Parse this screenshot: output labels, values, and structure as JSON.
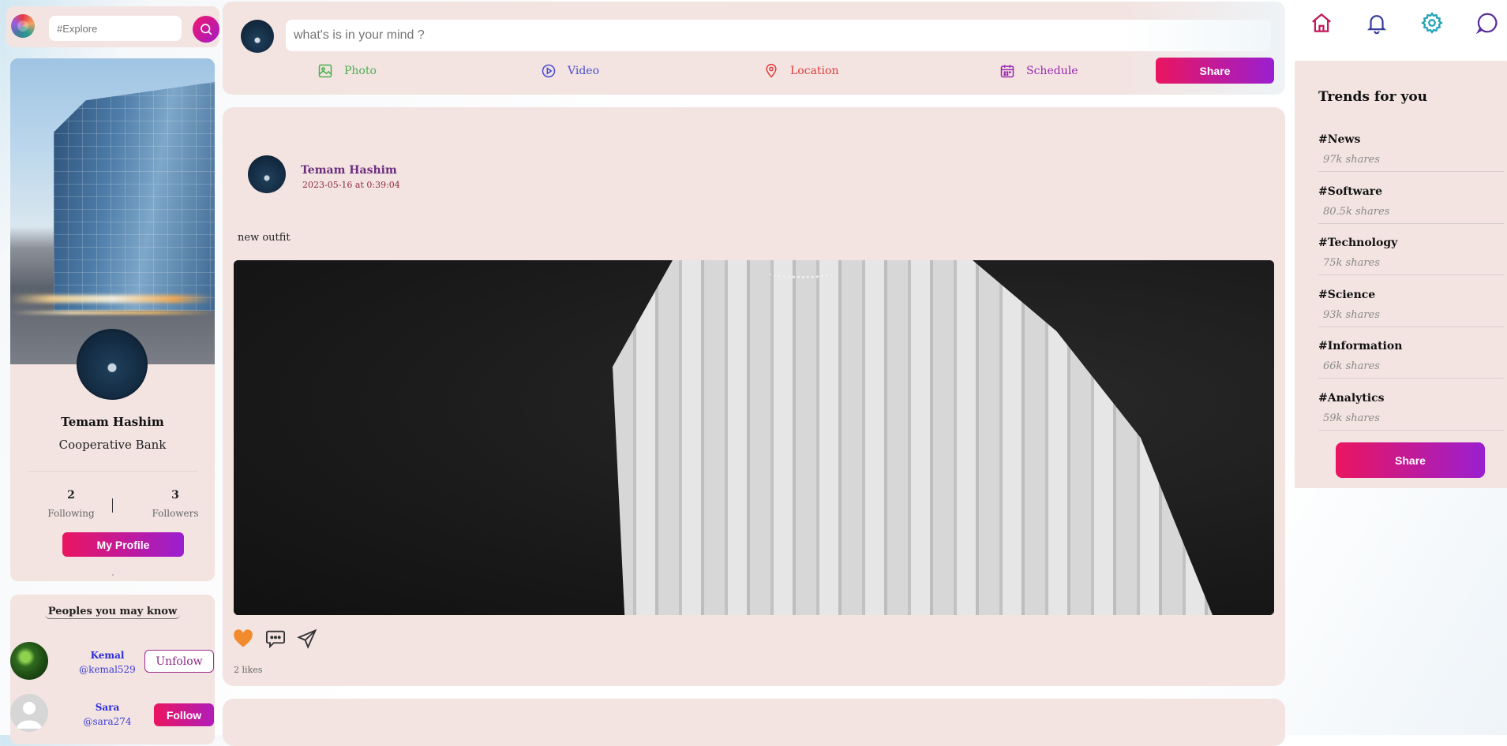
{
  "search": {
    "placeholder": "#Explore"
  },
  "profile": {
    "name": "Temam Hashim",
    "company": "Cooperative Bank",
    "following_count": "2",
    "following_label": "Following",
    "followers_count": "3",
    "followers_label": "Followers",
    "my_profile_label": "My Profile"
  },
  "people": {
    "title": "Peoples you may know",
    "list": [
      {
        "name": "Kemal",
        "handle": "@kemal529",
        "action": "Unfolow"
      },
      {
        "name": "Sara",
        "handle": "@sara274",
        "action": "Follow"
      }
    ]
  },
  "composer": {
    "placeholder": "what's is in your mind ?",
    "options": [
      {
        "label": "Photo",
        "icon": "image-icon",
        "color": "#4caf50"
      },
      {
        "label": "Video",
        "icon": "play-circle-icon",
        "color": "#4a4ad0"
      },
      {
        "label": "Location",
        "icon": "map-pin-icon",
        "color": "#e23b3b"
      },
      {
        "label": "Schedule",
        "icon": "calendar-icon",
        "color": "#9b27b0"
      }
    ],
    "share_label": "Share"
  },
  "post": {
    "author": "Temam Hashim",
    "timestamp": "2023-05-16 at 0:39:04",
    "text": "new outfit",
    "likes": "2 likes"
  },
  "nav": {
    "icons": [
      "home-icon",
      "bell-icon",
      "gear-icon",
      "chat-icon"
    ],
    "colors": [
      "#c2185b",
      "#3a3f9e",
      "#1fa3b3",
      "#5a2d9e"
    ]
  },
  "trends": {
    "title": "Trends for you",
    "items": [
      {
        "tag": "#News",
        "shares": "97k shares"
      },
      {
        "tag": "#Software",
        "shares": "80.5k shares"
      },
      {
        "tag": "#Technology",
        "shares": "75k shares"
      },
      {
        "tag": "#Science",
        "shares": "93k shares"
      },
      {
        "tag": "#Information",
        "shares": "66k shares"
      },
      {
        "tag": "#Analytics",
        "shares": "59k shares"
      }
    ],
    "share_label": "Share"
  },
  "colors": {
    "accent_start": "#ea1560",
    "accent_end": "#9a1fd0",
    "card_bg": "#f3e4e2"
  }
}
